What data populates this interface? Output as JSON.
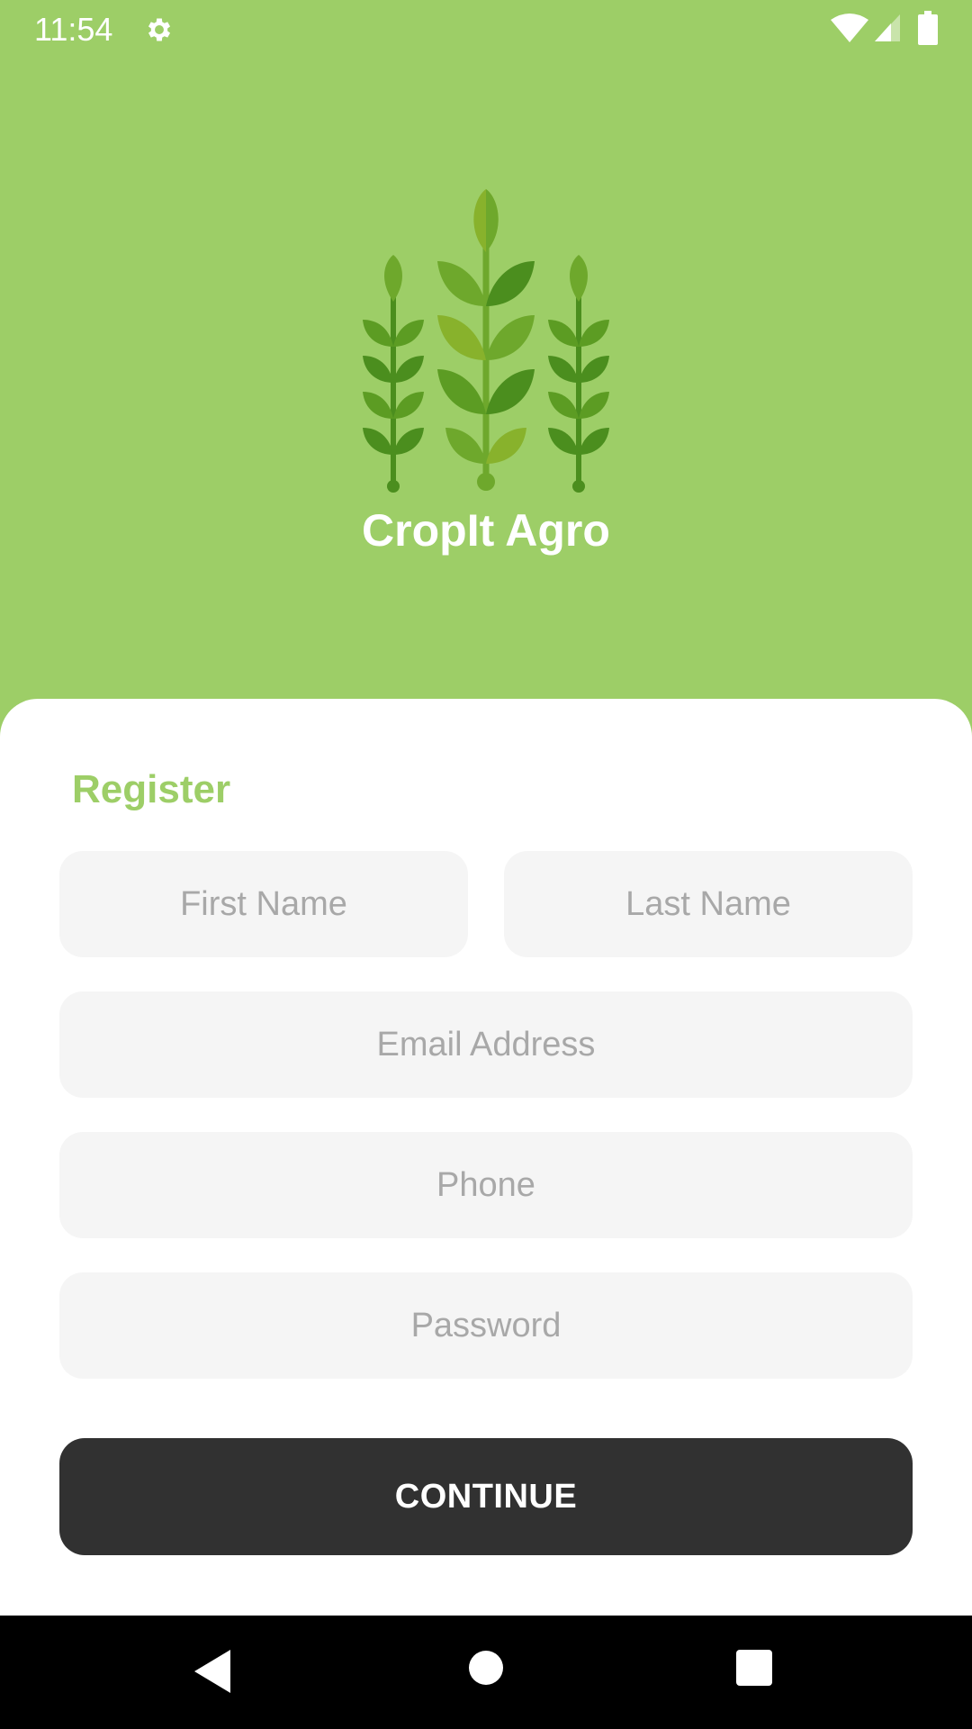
{
  "status_bar": {
    "time": "11:54",
    "icons": [
      "gear-icon",
      "wifi-icon",
      "cell-signal-icon",
      "battery-icon"
    ]
  },
  "header": {
    "app_name": "CropIt Agro",
    "logo_icon": "wheat-logo-icon"
  },
  "form": {
    "title": "Register",
    "first_name": {
      "placeholder": "First Name",
      "value": ""
    },
    "last_name": {
      "placeholder": "Last Name",
      "value": ""
    },
    "email": {
      "placeholder": "Email Address",
      "value": ""
    },
    "phone": {
      "placeholder": "Phone",
      "value": ""
    },
    "password": {
      "placeholder": "Password",
      "value": ""
    },
    "continue_label": "CONTINUE"
  },
  "nav_bar": {
    "icons": [
      "back-icon",
      "home-icon",
      "recents-icon"
    ]
  },
  "colors": {
    "brand_green": "#9dce67",
    "button_dark": "#313131",
    "field_bg": "#f5f5f5",
    "placeholder": "#a8a8a8"
  }
}
